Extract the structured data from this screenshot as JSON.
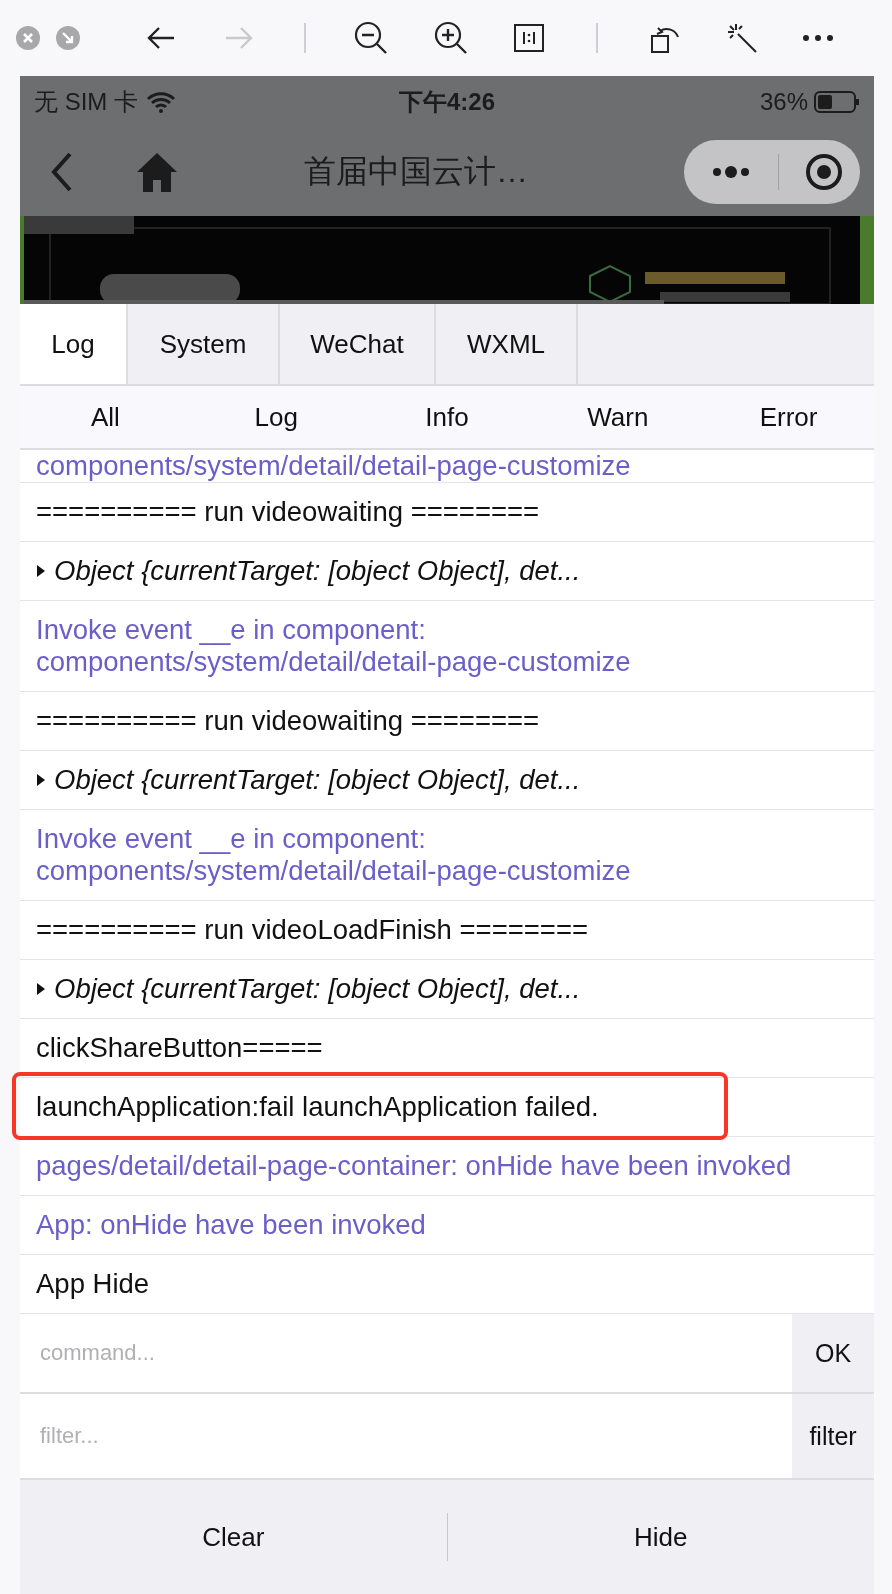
{
  "viewer_toolbar": {
    "forward_disabled": true
  },
  "status_bar": {
    "carrier": "无 SIM 卡",
    "time": "下午4:26",
    "battery": "36%"
  },
  "nav_bar": {
    "title": "首届中国云计…"
  },
  "tabs": [
    {
      "label": "Log",
      "selected": true
    },
    {
      "label": "System",
      "selected": false
    },
    {
      "label": "WeChat",
      "selected": false
    },
    {
      "label": "WXML",
      "selected": false
    }
  ],
  "filters": [
    {
      "label": "All"
    },
    {
      "label": "Log"
    },
    {
      "label": "Info"
    },
    {
      "label": "Warn"
    },
    {
      "label": "Error"
    }
  ],
  "log_rows": [
    {
      "kind": "info",
      "text": "components/system/detail/detail-page-customize",
      "highlighted": false
    },
    {
      "kind": "log",
      "text": "========== run videowaiting ========",
      "highlighted": false
    },
    {
      "kind": "object",
      "text": "Object {currentTarget: [object Object], det...",
      "highlighted": false
    },
    {
      "kind": "info",
      "text": "Invoke event __e in component: components/system/detail/detail-page-customize",
      "highlighted": false
    },
    {
      "kind": "log",
      "text": "========== run videowaiting ========",
      "highlighted": false
    },
    {
      "kind": "object",
      "text": "Object {currentTarget: [object Object], det...",
      "highlighted": false
    },
    {
      "kind": "info",
      "text": "Invoke event __e in component: components/system/detail/detail-page-customize",
      "highlighted": false
    },
    {
      "kind": "log",
      "text": "========== run videoLoadFinish ========",
      "highlighted": false
    },
    {
      "kind": "object",
      "text": "Object {currentTarget: [object Object], det...",
      "highlighted": false
    },
    {
      "kind": "log",
      "text": "clickShareButton=====",
      "highlighted": false
    },
    {
      "kind": "log",
      "text": "launchApplication:fail launchApplication failed.",
      "highlighted": true
    },
    {
      "kind": "info",
      "text": "pages/detail/detail-page-container: onHide have been invoked",
      "highlighted": false
    },
    {
      "kind": "info",
      "text": "App: onHide have been invoked",
      "highlighted": false
    },
    {
      "kind": "log",
      "text": "App Hide",
      "highlighted": false
    }
  ],
  "command": {
    "placeholder": "command...",
    "button": "OK"
  },
  "filter": {
    "placeholder": "filter...",
    "button": "filter"
  },
  "bottom_buttons": [
    {
      "label": "Clear"
    },
    {
      "label": "Hide"
    }
  ]
}
